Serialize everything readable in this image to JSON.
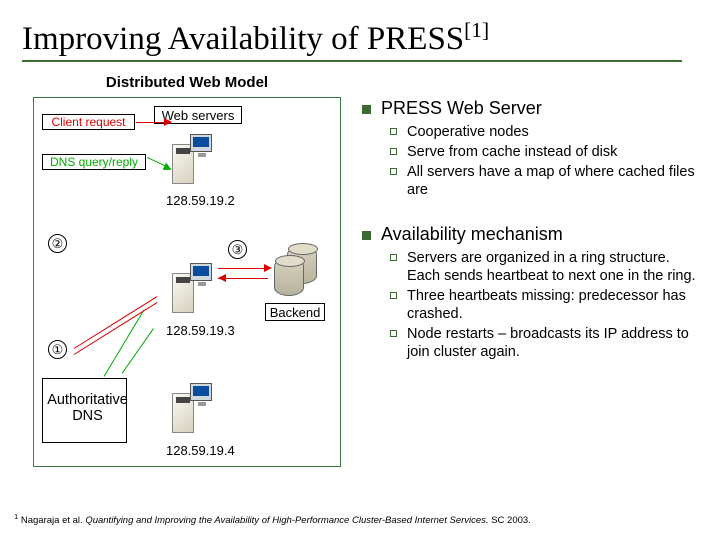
{
  "title": "Improving Availability of PRESS",
  "title_sup": "[1]",
  "left_title": "Distributed Web Model",
  "figure": {
    "client_request": "Client request",
    "dns_query": "DNS query/reply",
    "web_servers": "Web servers",
    "backend": "Backend",
    "ip1": "128.59.19.2",
    "ip2": "128.59.19.3",
    "ip3": "128.59.19.4",
    "circ1": "①",
    "circ2": "②",
    "circ3": "③",
    "auth_dns_l1": "Authoritative",
    "auth_dns_l2": "DNS"
  },
  "bullets": [
    {
      "text": "PRESS Web Server",
      "sub": [
        "Cooperative nodes",
        "Serve from cache instead of disk",
        "All servers have a map of where cached files are"
      ]
    },
    {
      "text": "Availability mechanism",
      "sub": [
        "Servers are organized in a ring structure. Each sends heartbeat to next one in the ring.",
        "Three heartbeats missing: predecessor has crashed.",
        "Node restarts – broadcasts its IP address to join cluster again."
      ]
    }
  ],
  "footnote_num": "1",
  "footnote_auth": " Nagaraja et al. ",
  "footnote_it": "Quantifying and Improving the Availability of High-Performance Cluster-Based Internet Services.",
  "footnote_tail": " SC 2003."
}
